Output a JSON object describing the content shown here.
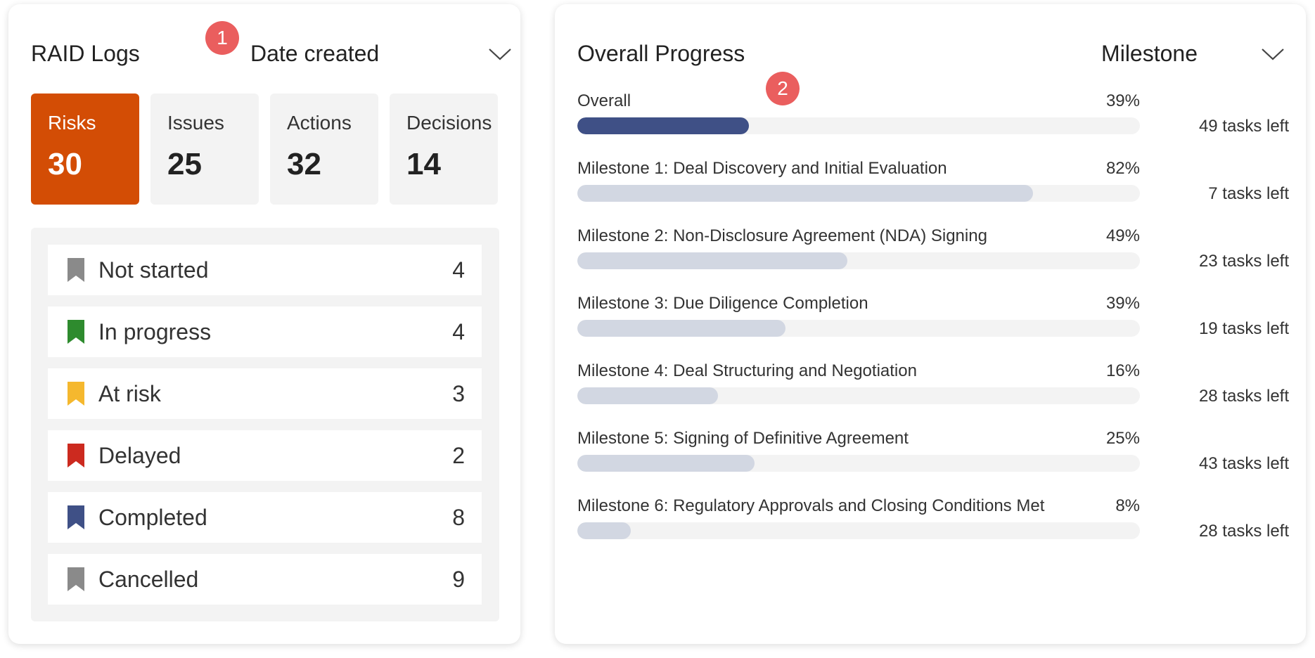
{
  "raid": {
    "title": "RAID Logs",
    "sort_label": "Date created",
    "badge": "1",
    "stats": [
      {
        "label": "Risks",
        "count": "30",
        "active": true
      },
      {
        "label": "Issues",
        "count": "25",
        "active": false
      },
      {
        "label": "Actions",
        "count": "32",
        "active": false
      },
      {
        "label": "Decisions",
        "count": "14",
        "active": false
      }
    ],
    "statuses": [
      {
        "label": "Not started",
        "count": "4",
        "color": "#8a8a8a",
        "icon": "bookmark-icon"
      },
      {
        "label": "In progress",
        "count": "4",
        "color": "#2e8b2e",
        "icon": "bookmark-icon"
      },
      {
        "label": "At risk",
        "count": "3",
        "color": "#f5b82e",
        "icon": "bookmark-icon"
      },
      {
        "label": "Delayed",
        "count": "2",
        "color": "#cc2a1f",
        "icon": "bookmark-icon"
      },
      {
        "label": "Completed",
        "count": "8",
        "color": "#3f5086",
        "icon": "bookmark-icon"
      },
      {
        "label": "Cancelled",
        "count": "9",
        "color": "#8a8a8a",
        "icon": "bookmark-icon"
      }
    ]
  },
  "progress": {
    "title": "Overall Progress",
    "group_label": "Milestone",
    "badge": "2",
    "accent_color": "#3f5086",
    "bar_color": "#d2d7e2",
    "items": [
      {
        "label": "Overall",
        "pct": "39%",
        "value": 0.305,
        "tasks_left": "49 tasks left"
      },
      {
        "label": "Milestone 1: Deal Discovery and Initial Evaluation",
        "pct": "82%",
        "value": 0.81,
        "tasks_left": "7 tasks left"
      },
      {
        "label": "Milestone 2: Non-Disclosure Agreement (NDA) Signing",
        "pct": "49%",
        "value": 0.48,
        "tasks_left": "23 tasks left"
      },
      {
        "label": "Milestone 3: Due Diligence Completion",
        "pct": "39%",
        "value": 0.37,
        "tasks_left": "19 tasks left"
      },
      {
        "label": "Milestone 4: Deal Structuring and Negotiation",
        "pct": "16%",
        "value": 0.25,
        "tasks_left": "28 tasks left"
      },
      {
        "label": "Milestone 5: Signing of Definitive Agreement",
        "pct": "25%",
        "value": 0.315,
        "tasks_left": "43 tasks left"
      },
      {
        "label": "Milestone 6: Regulatory Approvals and Closing Conditions Met",
        "pct": "8%",
        "value": 0.095,
        "tasks_left": "28 tasks left"
      }
    ]
  }
}
